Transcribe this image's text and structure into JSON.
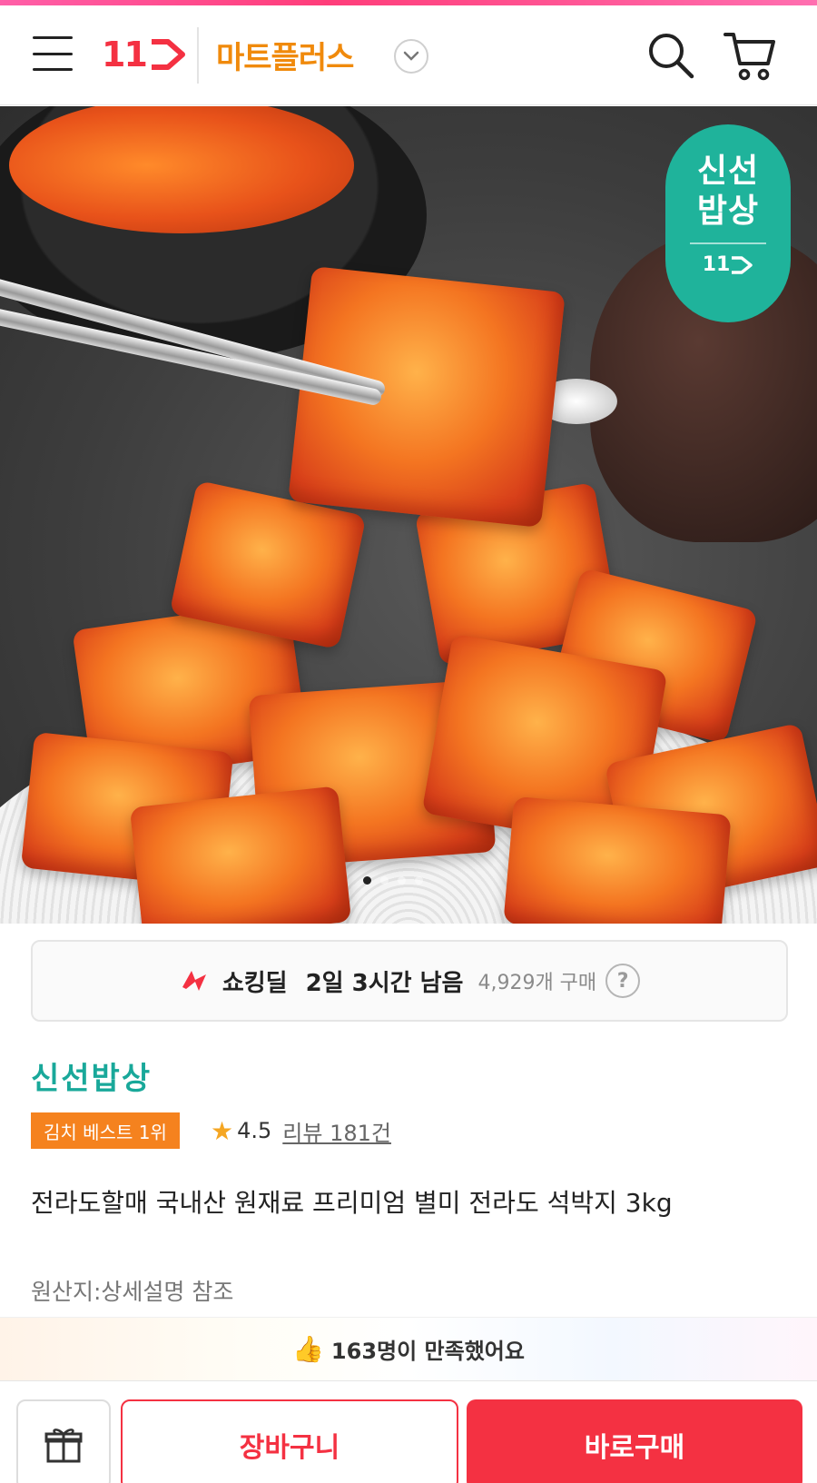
{
  "header": {
    "logo_text": "11",
    "store_name": "마트플러스",
    "colors": {
      "brand_red": "#f43142",
      "store_orange": "#f08a0c"
    },
    "icons": [
      "menu-icon",
      "chevron-down-icon",
      "search-icon",
      "cart-icon"
    ]
  },
  "hero": {
    "badge_line1": "신선",
    "badge_line2": "밥상",
    "badge_logo": "11",
    "badge_color": "#1fb39b",
    "slide_index": 1,
    "slide_count": 4
  },
  "deal": {
    "label": "쇼킹딜",
    "time_left": "2일 3시간 남음",
    "purchase_count": "4,929개 구매",
    "help_symbol": "?"
  },
  "product": {
    "brand": "신선밥상",
    "best_badge": "김치 베스트 1위",
    "rating": "4.5",
    "review_link": "리뷰 181건",
    "title": "전라도할매 국내산 원재료 프리미엄 별미 전라도 석박지 3kg",
    "origin": "원산지:상세설명 참조"
  },
  "satisfaction": {
    "text": "163명이 만족했어요"
  },
  "bottom_bar": {
    "cart_label": "장바구니",
    "buy_label": "바로구매"
  }
}
